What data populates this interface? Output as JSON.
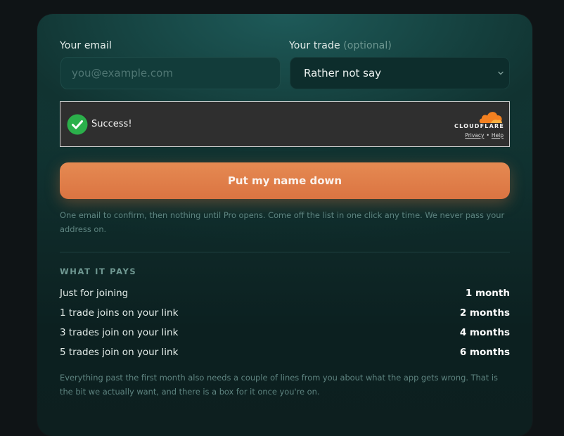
{
  "form": {
    "email_label": "Your email",
    "email_placeholder": "you@example.com",
    "email_value": "",
    "trade_label": "Your trade",
    "trade_optional": "(optional)",
    "trade_selected": "Rather not say"
  },
  "turnstile": {
    "status": "Success!",
    "brand": "CLOUDFLARE",
    "privacy_link": "Privacy",
    "separator": "•",
    "help_link": "Help",
    "brand_color": "#f38020",
    "success_color": "#2bb04b"
  },
  "cta": {
    "label": "Put my name down",
    "color": "#e07f48"
  },
  "note": "One email to confirm, then nothing until Pro opens. Come off the list in one click any time. We never pass your address on.",
  "pays": {
    "title": "WHAT IT PAYS",
    "rows": [
      {
        "label": "Just for joining",
        "value": "1 month"
      },
      {
        "label": "1 trade joins on your link",
        "value": "2 months"
      },
      {
        "label": "3 trades join on your link",
        "value": "4 months"
      },
      {
        "label": "5 trades join on your link",
        "value": "6 months"
      }
    ]
  },
  "footer_note": "Everything past the first month also needs a couple of lines from you about what the app gets wrong. That is the bit we actually want, and there is a box for it once you're on."
}
